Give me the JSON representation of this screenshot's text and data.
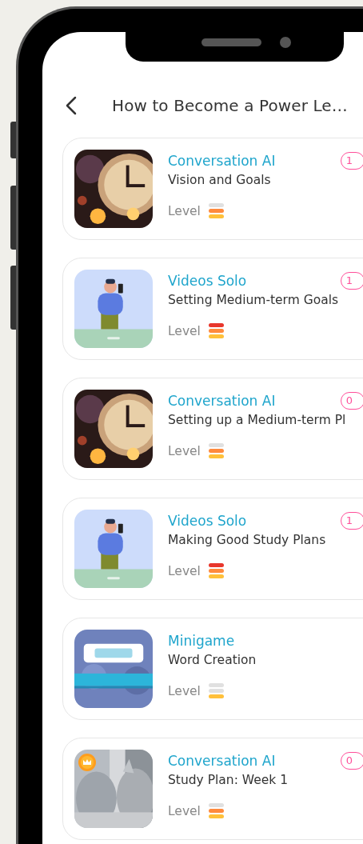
{
  "header": {
    "title": "How to Become a Power Le…"
  },
  "cards": [
    {
      "premium": false,
      "type": "Conversation AI",
      "title": "Vision and Goals",
      "level_label": "Level",
      "level": 0.67,
      "badge": "1"
    },
    {
      "premium": false,
      "type": "Videos Solo",
      "title": "Setting Medium-term Goals",
      "level_label": "Level",
      "level": 1,
      "badge": "1"
    },
    {
      "premium": false,
      "type": "Conversation AI",
      "title": "Setting up a Medium-term Pl",
      "level_label": "Level",
      "level": 0.67,
      "badge": "0"
    },
    {
      "premium": false,
      "type": "Videos Solo",
      "title": "Making Good Study Plans",
      "level_label": "Level",
      "level": 1,
      "badge": "1"
    },
    {
      "premium": false,
      "type": "Minigame",
      "title": "Word Creation",
      "level_label": "Level",
      "level": 0.33
    },
    {
      "premium": true,
      "type": "Conversation AI",
      "title": "Study Plan: Week 1",
      "level_label": "Level",
      "level": 0.67,
      "badge": "0"
    }
  ]
}
